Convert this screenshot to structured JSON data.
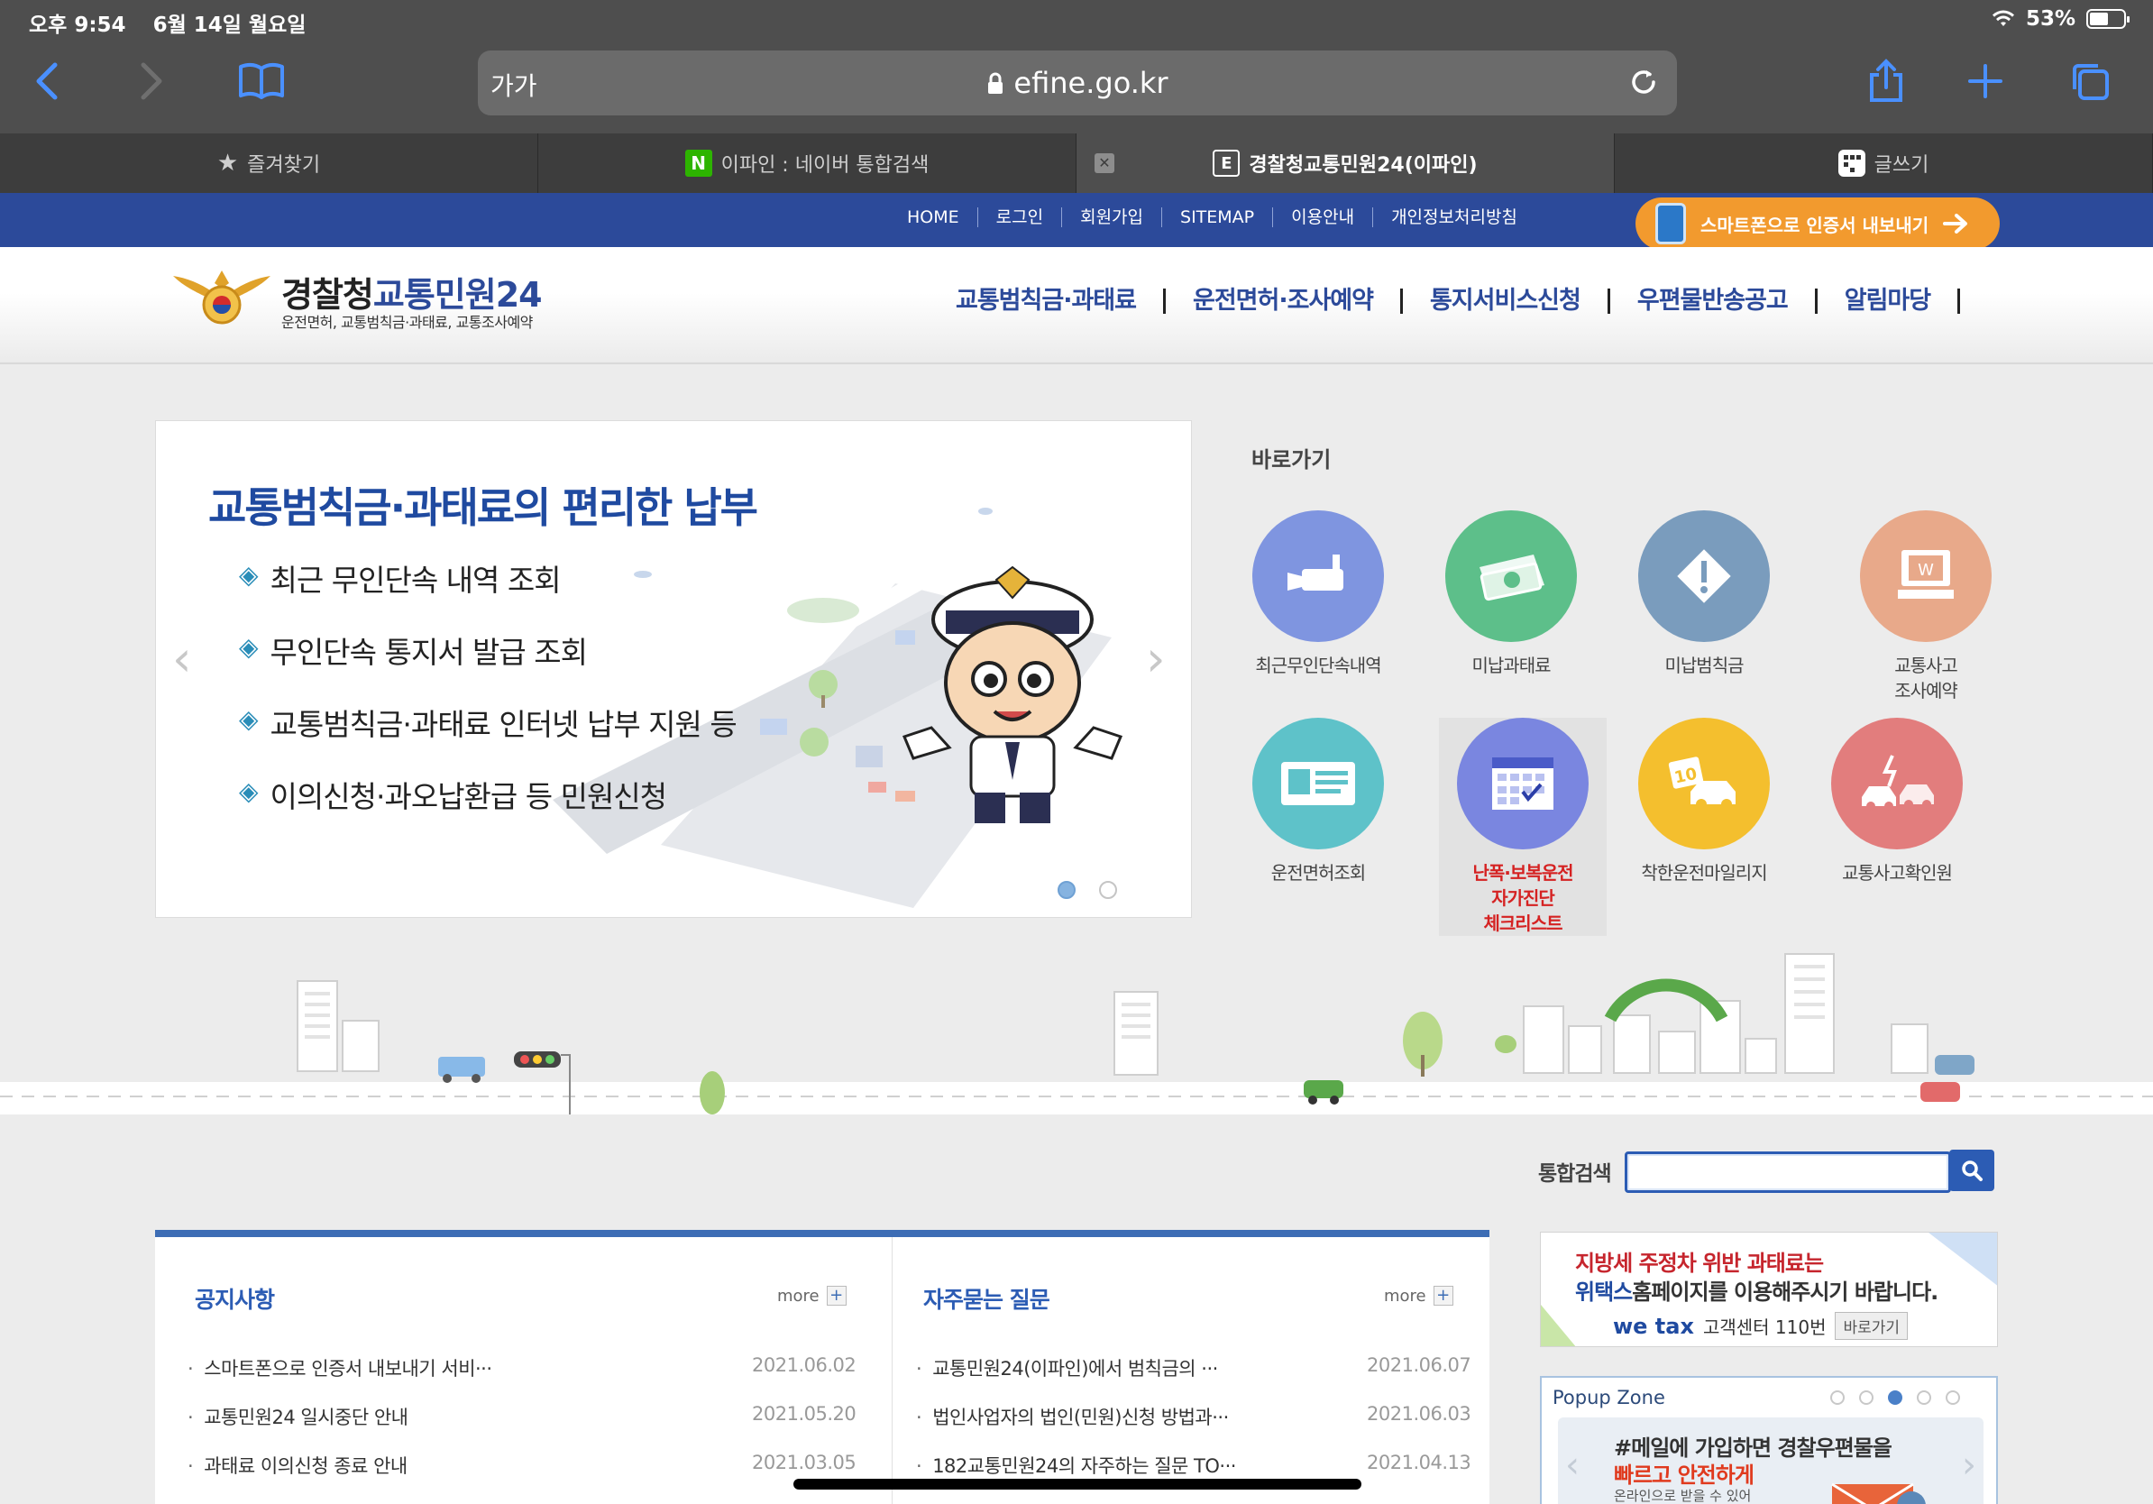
{
  "status": {
    "time": "오후 9:54",
    "date": "6월 14일 월요일",
    "battery": "53%"
  },
  "browser": {
    "aa": "가가",
    "url": "efine.go.kr",
    "tabs": [
      {
        "label": "즐겨찾기"
      },
      {
        "label": "이파인 : 네이버 통합검색"
      },
      {
        "label": "경찰청교통민원24(이파인)"
      },
      {
        "label": "글쓰기"
      }
    ]
  },
  "topnav": {
    "links": [
      "HOME",
      "로그인",
      "회원가입",
      "SITEMAP",
      "이용안내",
      "개인정보처리방침"
    ],
    "cert_button": "스마트폰으로 인증서 내보내기"
  },
  "header": {
    "title_a": "경찰청",
    "title_b": "교통민원24",
    "subtitle": "운전면허, 교통범칙금·과태료, 교통조사예약",
    "menu": [
      "교통범칙금·과태료",
      "운전면허·조사예약",
      "통지서비스신청",
      "우편물반송공고",
      "알림마당"
    ]
  },
  "banner": {
    "title": "교통범칙금·과태료의 편리한 납부",
    "items": [
      "최근 무인단속 내역 조회",
      "무인단속 통지서 발급 조회",
      "교통범칙금·과태료 인터넷 납부 지원 등",
      "이의신청·과오납환급 등 민원신청"
    ],
    "active_slide": 1,
    "slide_count": 2
  },
  "quick": {
    "title": "바로가기",
    "items": [
      {
        "label": "최근무인단속내역",
        "color": "#7f95e0",
        "icon": "camera-icon"
      },
      {
        "label": "미납과태료",
        "color": "#5dbf8a",
        "icon": "money-icon"
      },
      {
        "label": "미납범칙금",
        "color": "#7a9cbd",
        "icon": "warning-icon"
      },
      {
        "label": "교통사고\n조사예약",
        "color": "#e8a98a",
        "icon": "computer-icon"
      },
      {
        "label": "운전면허조회",
        "color": "#5ec2c9",
        "icon": "license-card-icon"
      },
      {
        "label": "난폭·보복운전\n자가진단\n체크리스트",
        "color": "#7a86e0",
        "icon": "calendar-check-icon"
      },
      {
        "label": "착한운전마일리지",
        "color": "#f4bf2e",
        "icon": "mileage-car-icon"
      },
      {
        "label": "교통사고확인원",
        "color": "#e27d7d",
        "icon": "accident-icon"
      }
    ]
  },
  "search": {
    "label": "통합검색",
    "placeholder": ""
  },
  "notice": {
    "title": "공지사항",
    "more": "more",
    "items": [
      {
        "text": "스마트폰으로 인증서 내보내기 서비···",
        "date": "2021.06.02"
      },
      {
        "text": "교통민원24 일시중단 안내",
        "date": "2021.05.20"
      },
      {
        "text": "과태료 이의신청 종료 안내",
        "date": "2021.03.05"
      }
    ]
  },
  "faq": {
    "title": "자주묻는 질문",
    "more": "more",
    "items": [
      {
        "text": "교통민원24(이파인)에서 범칙금의 ···",
        "date": "2021.06.07"
      },
      {
        "text": "법인사업자의 법인(민원)신청 방법과···",
        "date": "2021.06.03"
      },
      {
        "text": "182교통민원24의 자주하는 질문 TO···",
        "date": "2021.04.13"
      }
    ]
  },
  "wetax": {
    "line1": "지방세 주정차 위반 과태료는",
    "line2_bold": "위택스",
    "line2_rest": "홈페이지를 이용해주시기 바랍니다.",
    "logo": "we tax",
    "center": "고객센터 110번",
    "go": "바로가기"
  },
  "popup": {
    "title": "Popup Zone",
    "active_dot": 3,
    "dot_count": 5,
    "line1": "#메일에 가입하면 경찰우편물을",
    "line2": "빠르고 안전하게",
    "line3": "온라인으로 받을 수 있어"
  }
}
